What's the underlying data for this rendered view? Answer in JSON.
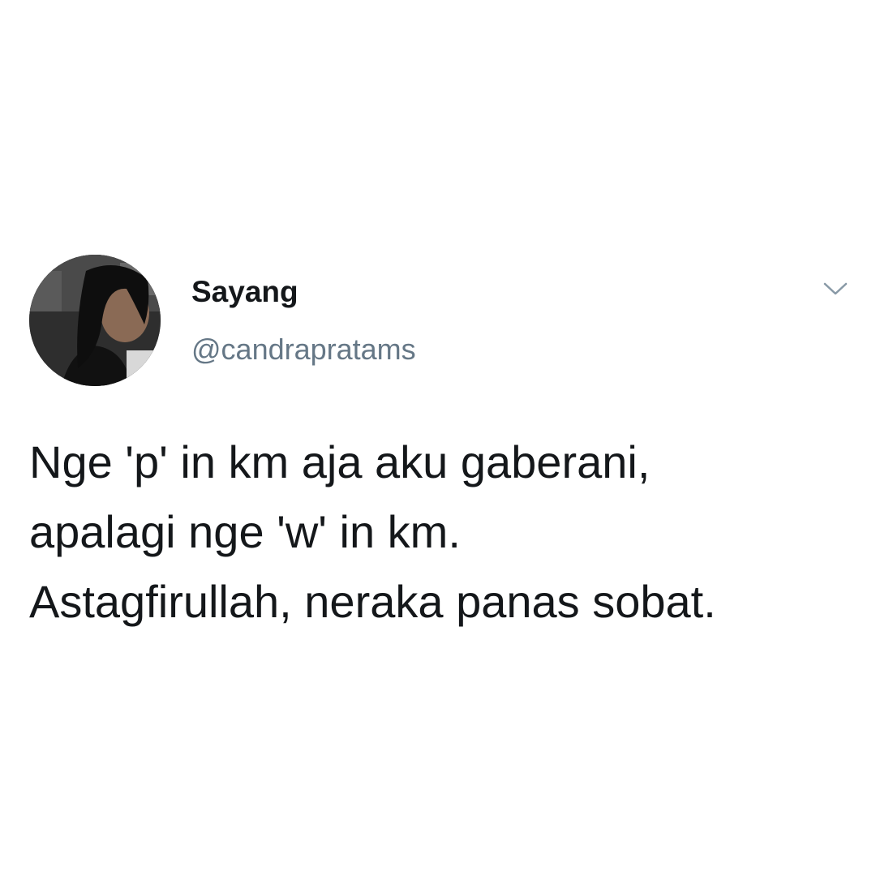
{
  "tweet": {
    "author": {
      "display_name": "Sayang",
      "handle": "@candrapratams",
      "avatar_icon": "profile-photo"
    },
    "menu_icon": "chevron-down-icon",
    "text_lines": [
      "Nge 'p' in km aja aku gaberani,",
      "apalagi nge 'w' in km.",
      "Astagfirullah, neraka panas sobat."
    ]
  },
  "colors": {
    "background": "#ffffff",
    "primary_text": "#14171a",
    "secondary_text": "#657786",
    "caret": "#8899a6"
  }
}
